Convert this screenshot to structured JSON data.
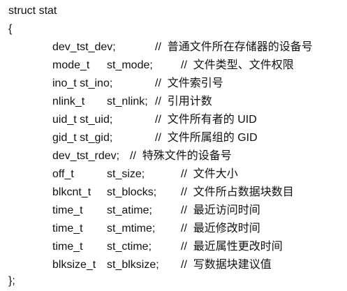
{
  "code": {
    "header": "struct stat",
    "open_brace": "{",
    "close_brace": "};",
    "fields": [
      {
        "type": "dev_tst_dev;",
        "name": "",
        "comment": "//  普通文件所在存储器的设备号"
      },
      {
        "type": "mode_t",
        "name": "st_mode;",
        "comment": "//  文件类型、文件权限"
      },
      {
        "type": "ino_t st_ino;",
        "name": "",
        "comment": "//  文件索引号"
      },
      {
        "type": "nlink_t",
        "name": "st_nlink;",
        "comment": "//  引用计数"
      },
      {
        "type": "uid_t st_uid;",
        "name": "",
        "comment": "//  文件所有者的 UID"
      },
      {
        "type": "gid_t st_gid;",
        "name": "",
        "comment": "//  文件所属组的 GID"
      },
      {
        "type": "dev_tst_rdev;",
        "name": "",
        "comment": "//  特殊文件的设备号"
      },
      {
        "type": "off_t",
        "name": "st_size;",
        "comment": "//  文件大小"
      },
      {
        "type": "blkcnt_t",
        "name": "st_blocks;",
        "comment": "//  文件所占数据块数目"
      },
      {
        "type": "time_t",
        "name": "st_atime;",
        "comment": "//  最近访问时间"
      },
      {
        "type": "time_t",
        "name": "st_mtime;",
        "comment": "//  最近修改时间"
      },
      {
        "type": "time_t",
        "name": "st_ctime;",
        "comment": "//  最近属性更改时间"
      },
      {
        "type": "blksize_t",
        "name": "st_blksize;",
        "comment": "//  写数据块建议值"
      }
    ]
  }
}
